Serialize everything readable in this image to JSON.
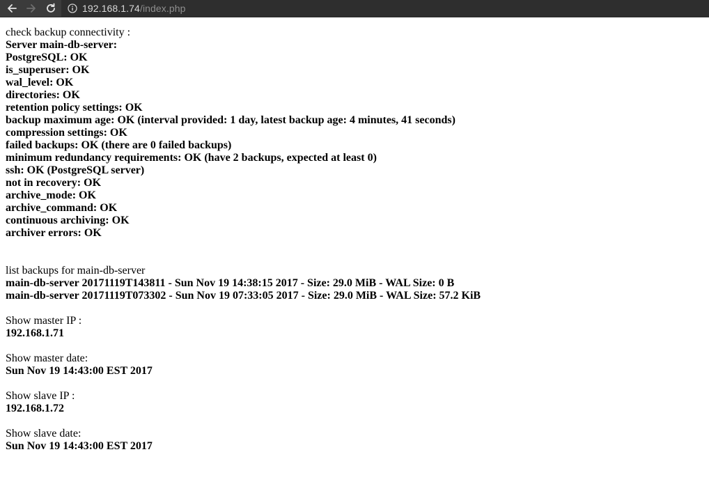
{
  "browser": {
    "url_host": "192.168.1.74",
    "url_path": "/index.php"
  },
  "check": {
    "heading": "check backup connectivity :",
    "lines": [
      "Server main-db-server:",
      "PostgreSQL: OK",
      "is_superuser: OK",
      "wal_level: OK",
      "directories: OK",
      "retention policy settings: OK",
      "backup maximum age: OK (interval provided: 1 day, latest backup age: 4 minutes, 41 seconds)",
      "compression settings: OK",
      "failed backups: OK (there are 0 failed backups)",
      "minimum redundancy requirements: OK (have 2 backups, expected at least 0)",
      "ssh: OK (PostgreSQL server)",
      "not in recovery: OK",
      "archive_mode: OK",
      "archive_command: OK",
      "continuous archiving: OK",
      "archiver errors: OK"
    ]
  },
  "backups": {
    "heading": "list backups for main-db-server",
    "items": [
      "main-db-server 20171119T143811 - Sun Nov 19 14:38:15 2017 - Size: 29.0 MiB - WAL Size: 0 B",
      "main-db-server 20171119T073302 - Sun Nov 19 07:33:05 2017 - Size: 29.0 MiB - WAL Size: 57.2 KiB"
    ]
  },
  "master_ip": {
    "label": "Show master IP :",
    "value": "192.168.1.71"
  },
  "master_date": {
    "label": "Show master date:",
    "value": "Sun Nov 19 14:43:00 EST 2017"
  },
  "slave_ip": {
    "label": "Show slave IP :",
    "value": "192.168.1.72"
  },
  "slave_date": {
    "label": "Show slave date:",
    "value": "Sun Nov 19 14:43:00 EST 2017"
  }
}
